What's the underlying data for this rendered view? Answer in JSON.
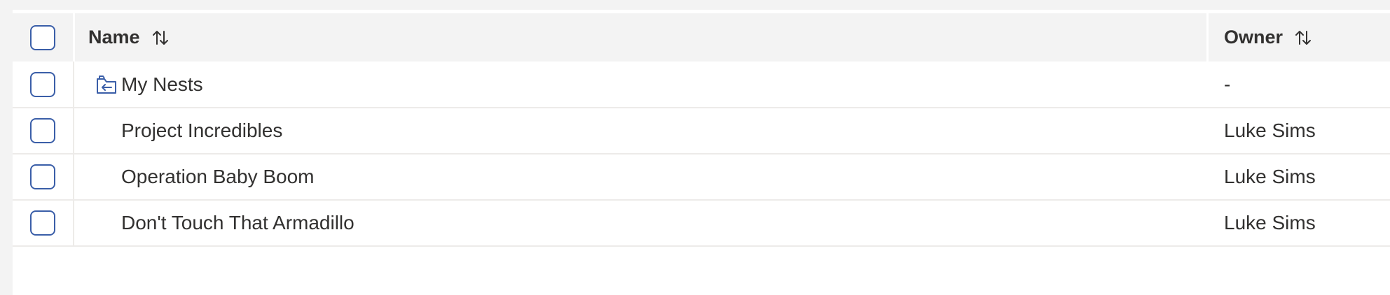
{
  "table": {
    "header": {
      "name_label": "Name",
      "owner_label": "Owner"
    },
    "rows": [
      {
        "name": "My Nests",
        "owner": "-",
        "icon": "shared-folder-icon"
      },
      {
        "name": "Project Incredibles",
        "owner": "Luke Sims"
      },
      {
        "name": "Operation Baby Boom",
        "owner": "Luke Sims"
      },
      {
        "name": "Don't Touch That Armadillo",
        "owner": "Luke Sims"
      }
    ]
  },
  "colors": {
    "accent": "#3a5ea8",
    "header_bg": "#f3f3f3",
    "text": "#323130",
    "divider": "#edebe9"
  }
}
